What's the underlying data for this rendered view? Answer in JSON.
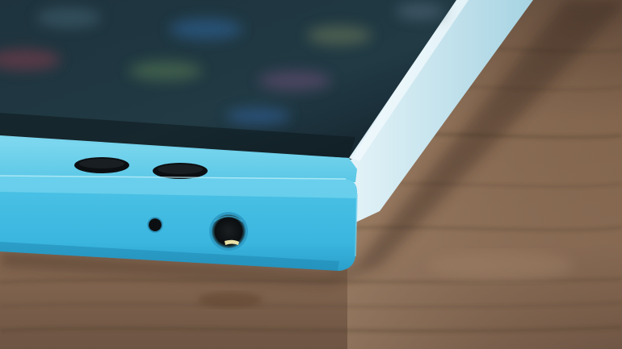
{
  "scene": {
    "subject": "smartphone-top-edge-on-wooden-table",
    "colors": {
      "wood_light": "#9a7c63",
      "wood_mid": "#7a5f4a",
      "wood_dark": "#4f3d31",
      "phone_body": "#4cc4e6",
      "phone_body_shade": "#2aa4cf",
      "phone_body_highlight": "#8ee0f4",
      "side_panel": "#c8e8f2",
      "screen_dark": "#182a33",
      "port_black": "#0c0f12"
    },
    "elements": {
      "screen_icons_visible": true,
      "earpiece_holes": 2,
      "microphone_hole": true,
      "headphone_jack": true
    }
  }
}
